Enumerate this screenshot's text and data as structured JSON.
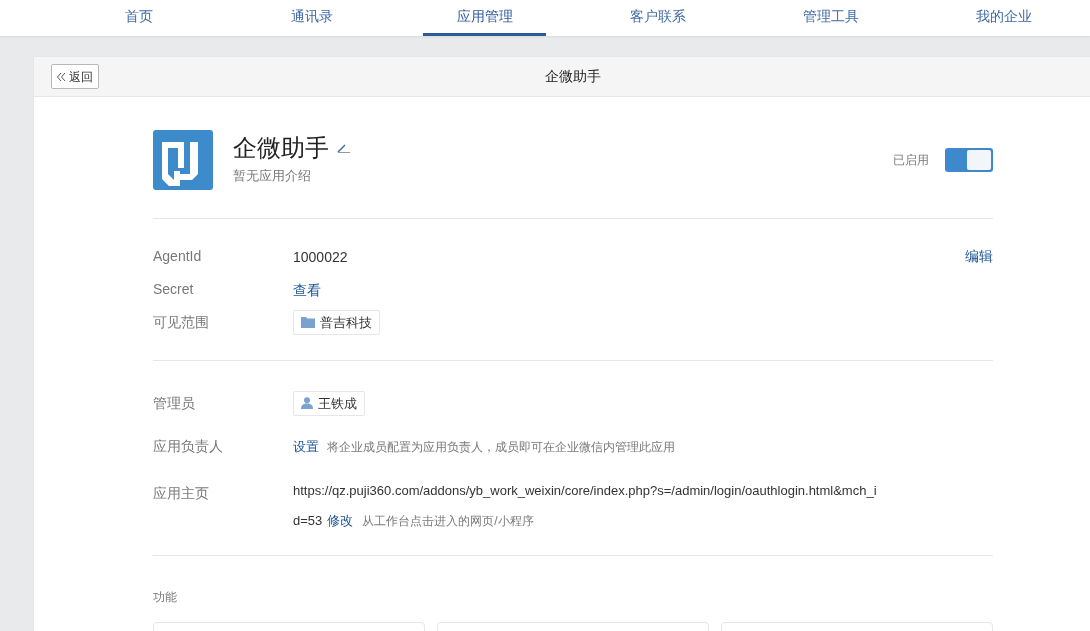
{
  "nav": [
    {
      "label": "首页",
      "selected": false
    },
    {
      "label": "通讯录",
      "selected": false
    },
    {
      "label": "应用管理",
      "selected": true
    },
    {
      "label": "客户联系",
      "selected": false
    },
    {
      "label": "管理工具",
      "selected": false
    },
    {
      "label": "我的企业",
      "selected": false
    }
  ],
  "header": {
    "back": "返回",
    "title": "企微助手"
  },
  "app": {
    "name": "企微助手",
    "description": "暂无应用介绍",
    "status": "已启用",
    "enabled": true
  },
  "info": {
    "edit": "编辑",
    "rows": [
      {
        "kind": "text",
        "label": "AgentId",
        "value": "1000022"
      },
      {
        "kind": "link",
        "label": "Secret",
        "value": "查看"
      },
      {
        "kind": "department",
        "label": "可见范围",
        "value": "普吉科技"
      }
    ]
  },
  "admin": {
    "rows": [
      {
        "kind": "member",
        "label": "管理员",
        "value": "王铁成"
      },
      {
        "kind": "link_hint",
        "label": "应用负责人",
        "value": "设置",
        "hint": "将企业成员配置为应用负责人，成员即可在企业微信内管理此应用"
      },
      {
        "kind": "url",
        "label": "应用主页",
        "value_lines": [
          "https://qz.puji360.com/addons/yb_work_weixin/core/index.php?s=/admin/login/oauthlogin.html&mch_i",
          "d=53"
        ],
        "link": "修改",
        "hint": "从工作台点击进入的网页/小程序"
      }
    ]
  },
  "features": {
    "title": "功能"
  }
}
